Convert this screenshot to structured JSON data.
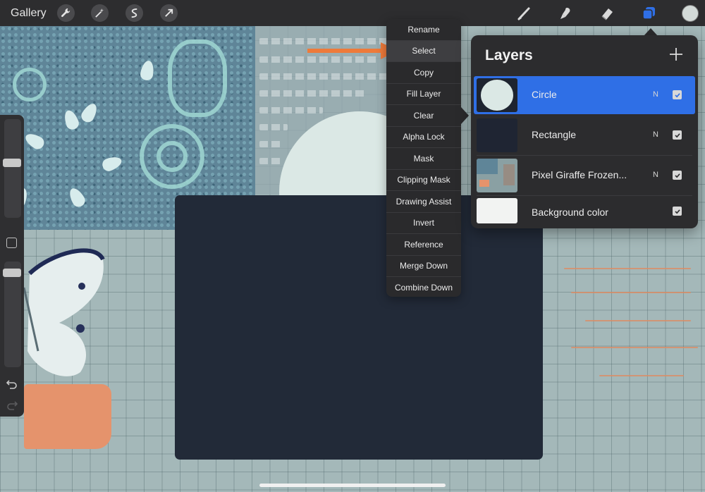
{
  "topbar": {
    "gallery_label": "Gallery",
    "left_tools": [
      "wrench-icon",
      "magic-wand-icon",
      "selection-icon",
      "transform-arrow-icon"
    ],
    "right_tools": [
      "brush-icon",
      "smudge-icon",
      "eraser-icon",
      "layers-icon"
    ],
    "active_color": "#d3dad8",
    "active_tool_color": "#2f6fe6"
  },
  "context_menu": {
    "items": [
      "Rename",
      "Select",
      "Copy",
      "Fill Layer",
      "Clear",
      "Alpha Lock",
      "Mask",
      "Clipping Mask",
      "Drawing Assist",
      "Invert",
      "Reference",
      "Merge Down",
      "Combine Down"
    ],
    "highlighted": "Select",
    "annotation_arrow_color": "#ee7a3a"
  },
  "layers_panel": {
    "title": "Layers",
    "layers": [
      {
        "name": "Circle",
        "blend": "N",
        "visible": true,
        "selected": true
      },
      {
        "name": "Rectangle",
        "blend": "N",
        "visible": true,
        "selected": false
      },
      {
        "name": "Pixel Giraffe Frozen...",
        "blend": "N",
        "visible": true,
        "selected": false
      },
      {
        "name": "Background color",
        "blend": "",
        "visible": true,
        "selected": false
      }
    ]
  },
  "colors": {
    "accent": "#2f6fe6",
    "toolbar_bg": "#2d2d2f",
    "rectangle_fill": "#222a38",
    "circle_fill": "#dbe8e5"
  }
}
